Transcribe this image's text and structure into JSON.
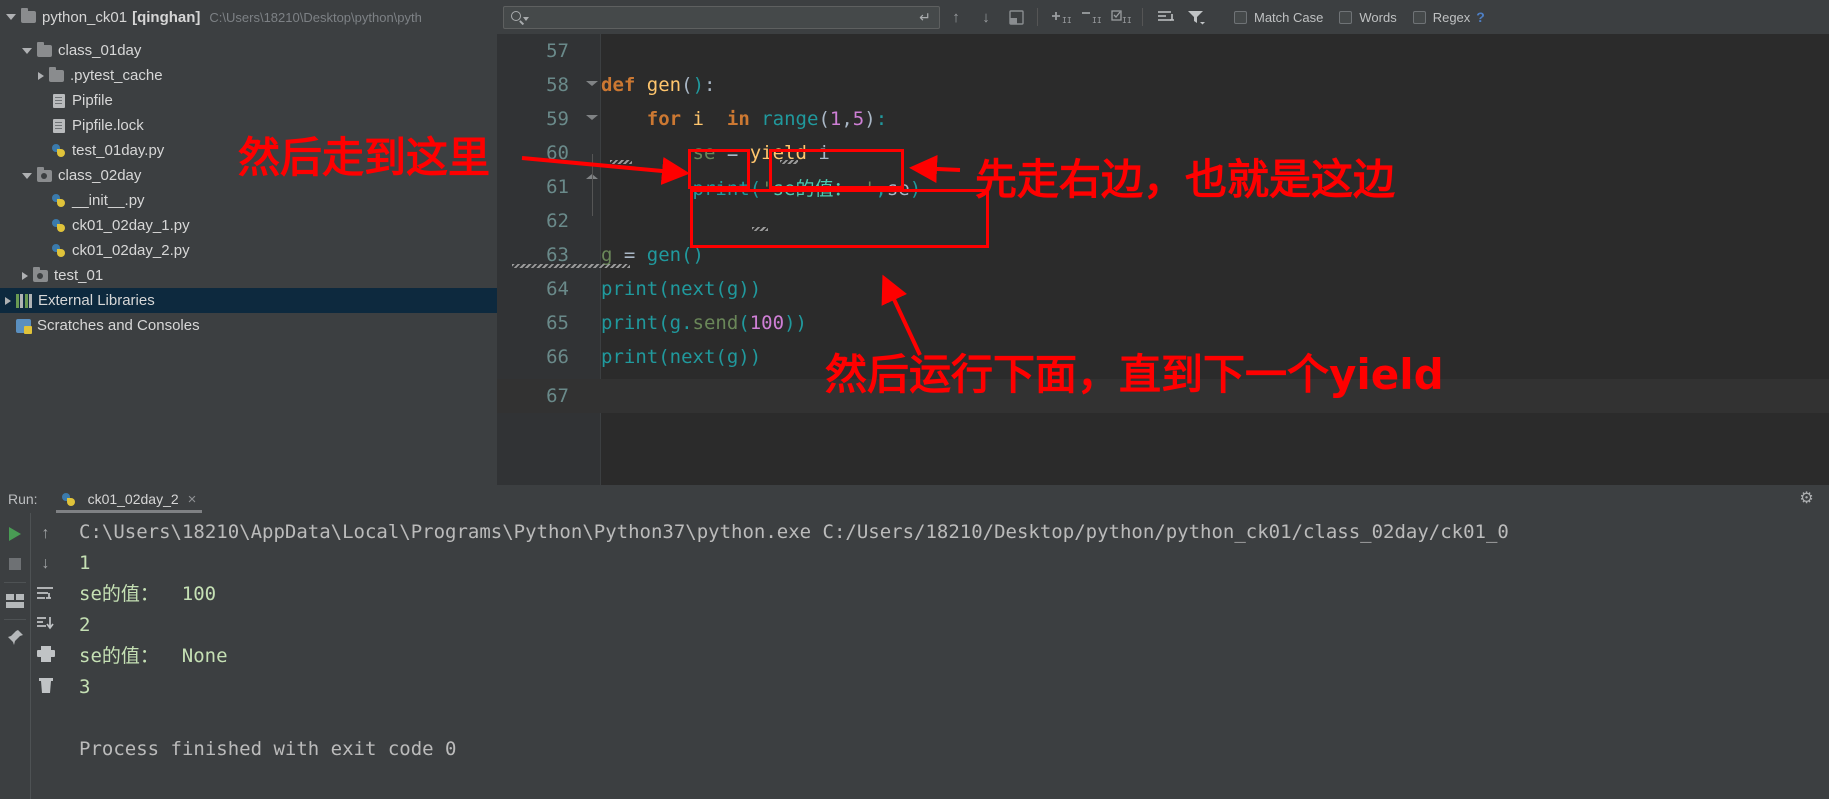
{
  "project": {
    "name": "python_ck01",
    "tag": "[qinghan]",
    "path": "C:\\Users\\18210\\Desktop\\python\\pyth",
    "tree": [
      {
        "label": "class_01day",
        "indent": 1,
        "icon": "folder",
        "arrow": "open",
        "selected": false
      },
      {
        "label": ".pytest_cache",
        "indent": 2,
        "icon": "folder",
        "arrow": "closed",
        "selected": false
      },
      {
        "label": "Pipfile",
        "indent": 3,
        "icon": "text-file",
        "arrow": "none",
        "selected": false
      },
      {
        "label": "Pipfile.lock",
        "indent": 3,
        "icon": "text-file",
        "arrow": "none",
        "selected": false
      },
      {
        "label": "test_01day.py",
        "indent": 3,
        "icon": "python-file",
        "arrow": "none",
        "selected": false
      },
      {
        "label": "class_02day",
        "indent": 1,
        "icon": "folder-mod",
        "arrow": "open",
        "selected": false
      },
      {
        "label": "__init__.py",
        "indent": 3,
        "icon": "python-file",
        "arrow": "none",
        "selected": false
      },
      {
        "label": "ck01_02day_1.py",
        "indent": 3,
        "icon": "python-file",
        "arrow": "none",
        "selected": false
      },
      {
        "label": "ck01_02day_2.py",
        "indent": 3,
        "icon": "python-file",
        "arrow": "none",
        "selected": false
      },
      {
        "label": "test_01",
        "indent": 1,
        "icon": "folder-mod",
        "arrow": "closed",
        "selected": false
      },
      {
        "label": "External Libraries",
        "indent": 0,
        "icon": "libraries",
        "arrow": "closed",
        "selected": true
      },
      {
        "label": "Scratches and Consoles",
        "indent": 0,
        "icon": "scratches",
        "arrow": "none",
        "selected": false
      }
    ]
  },
  "search": {
    "value": "",
    "placeholder": "",
    "icons": [
      "search-icon",
      "dropdown-caret-icon",
      "enter-icon"
    ]
  },
  "toolbar": {
    "buttons": [
      {
        "name": "find-previous-icon",
        "glyph": "↑"
      },
      {
        "name": "find-next-icon",
        "glyph": "↓"
      },
      {
        "name": "select-window-icon",
        "glyph": "❐"
      },
      {
        "name": "add-line-icon",
        "glyph": "+"
      },
      {
        "name": "remove-line-icon",
        "glyph": "−"
      },
      {
        "name": "select-all-icon",
        "glyph": "☑"
      },
      {
        "name": "wrap-lines-icon",
        "glyph": "≡"
      },
      {
        "name": "filter-icon",
        "glyph": "᎒"
      }
    ],
    "checkboxes": [
      {
        "label": "Match Case",
        "checked": false
      },
      {
        "label": "Words",
        "checked": false
      },
      {
        "label": "Regex",
        "checked": false
      }
    ],
    "help_label": "?"
  },
  "editor": {
    "lines": [
      {
        "num": "57",
        "text": "",
        "current": false
      },
      {
        "num": "58",
        "text": "def gen():",
        "current": false
      },
      {
        "num": "59",
        "text": "    for i  in range(1,5):",
        "current": false
      },
      {
        "num": "60",
        "text": "        se = yield i",
        "current": false
      },
      {
        "num": "61",
        "text": "        print('se的值： ',se)",
        "current": false
      },
      {
        "num": "62",
        "text": "",
        "current": false
      },
      {
        "num": "63",
        "text": "g = gen()",
        "current": false
      },
      {
        "num": "64",
        "text": "print(next(g))",
        "current": false
      },
      {
        "num": "65",
        "text": "print(g.send(100))",
        "current": false
      },
      {
        "num": "66",
        "text": "print(next(g))",
        "current": false
      },
      {
        "num": "67",
        "text": "",
        "current": true
      }
    ]
  },
  "run": {
    "label": "Run:",
    "tab_name": "ck01_02day_2",
    "close_glyph": "×",
    "settings_glyph": "⚙",
    "side_buttons": [
      {
        "name": "rerun-button",
        "glyph": "play"
      },
      {
        "name": "stop-button",
        "glyph": "stop"
      },
      {
        "name": "restore-layout-button",
        "glyph": "layout"
      },
      {
        "name": "pin-tab-button",
        "glyph": "✒"
      },
      {
        "name": "scroll-up-button",
        "glyph": "↑"
      },
      {
        "name": "scroll-down-button",
        "glyph": "↓"
      },
      {
        "name": "soft-wrap-button",
        "glyph": "↩"
      },
      {
        "name": "scroll-to-end-button",
        "glyph": "↧"
      },
      {
        "name": "print-button",
        "glyph": "⎙"
      },
      {
        "name": "clear-all-button",
        "glyph": "Ὕ1"
      }
    ],
    "console": [
      {
        "text": "C:\\Users\\18210\\AppData\\Local\\Programs\\Python\\Python37\\python.exe C:/Users/18210/Desktop/python/python_ck01/class_02day/ck01_0",
        "kind": "cmd"
      },
      {
        "text": "1",
        "kind": "out"
      },
      {
        "text": "se的值：  100",
        "kind": "out"
      },
      {
        "text": "2",
        "kind": "out"
      },
      {
        "text": "se的值：  None",
        "kind": "out"
      },
      {
        "text": "3",
        "kind": "out"
      },
      {
        "text": "",
        "kind": "out"
      },
      {
        "text": "Process finished with exit code 0",
        "kind": "cmd"
      }
    ]
  },
  "annotations": [
    {
      "name": "annotation-then-go-here",
      "text": "然后走到这里",
      "color": "#ff0000"
    },
    {
      "name": "annotation-right-side-first",
      "text": "先走右边，也就是这边",
      "color": "#ff0000"
    },
    {
      "name": "annotation-run-until-yield",
      "text": "然后运行下面，直到下一个yield",
      "color": "#ff0000"
    }
  ]
}
